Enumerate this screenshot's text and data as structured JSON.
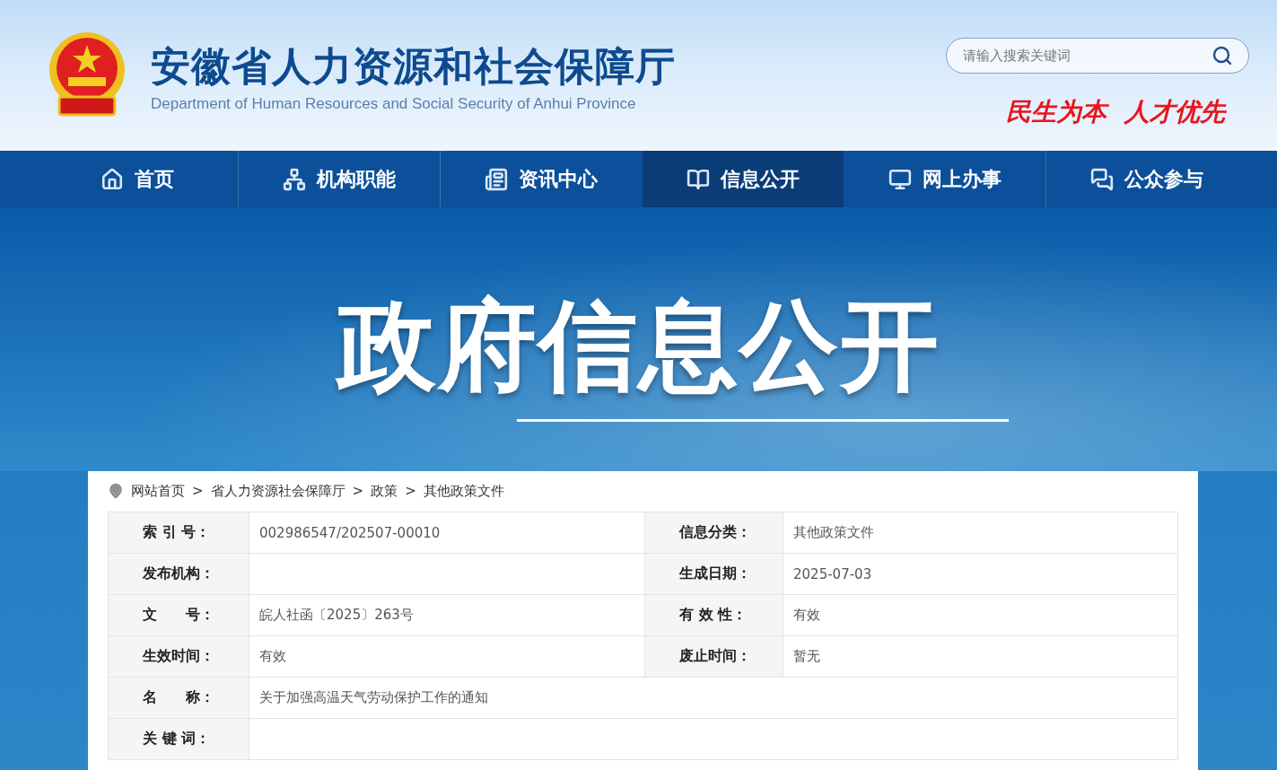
{
  "header": {
    "title": "安徽省人力资源和社会保障厅",
    "subtitle": "Department of Human Resources and Social Security of Anhui Province",
    "search": {
      "placeholder": "请输入搜索关键词"
    },
    "slogan": "民生为本  人才优先"
  },
  "nav": [
    {
      "label": "首页",
      "selected": false
    },
    {
      "label": "机构职能",
      "selected": false
    },
    {
      "label": "资讯中心",
      "selected": false
    },
    {
      "label": "信息公开",
      "selected": true
    },
    {
      "label": "网上办事",
      "selected": false
    },
    {
      "label": "公众参与",
      "selected": false
    }
  ],
  "banner": {
    "title": "政府信息公开"
  },
  "breadcrumb": [
    {
      "label": "网站首页"
    },
    {
      "separator": ">",
      "label": "省人力资源社会保障厅"
    },
    {
      "separator": ">",
      "label": "政策"
    },
    {
      "separator": ">",
      "label": "其他政策文件"
    }
  ],
  "info_table": [
    {
      "cells": [
        {
          "label": "索 引 号：",
          "value": "002986547/202507-00010"
        },
        {
          "label": "信息分类：",
          "value": "其他政策文件"
        }
      ]
    },
    {
      "cells": [
        {
          "label": "发布机构："
        },
        {
          "label": "生成日期：",
          "value": "2025-07-03"
        }
      ]
    },
    {
      "cells": [
        {
          "label": "文　　号：",
          "value": "皖人社函〔2025〕263号"
        },
        {
          "label": "有 效 性：",
          "value": "有效"
        }
      ]
    },
    {
      "cells": [
        {
          "label": "生效时间：",
          "value": "有效"
        },
        {
          "label": "废止时间：",
          "value": "暂无"
        }
      ]
    },
    {
      "cells": [
        {
          "label": "名　　称：",
          "value": "关于加强高温天气劳动保护工作的通知"
        }
      ]
    },
    {
      "cells": [
        {
          "label": "关 键 词："
        }
      ]
    }
  ]
}
